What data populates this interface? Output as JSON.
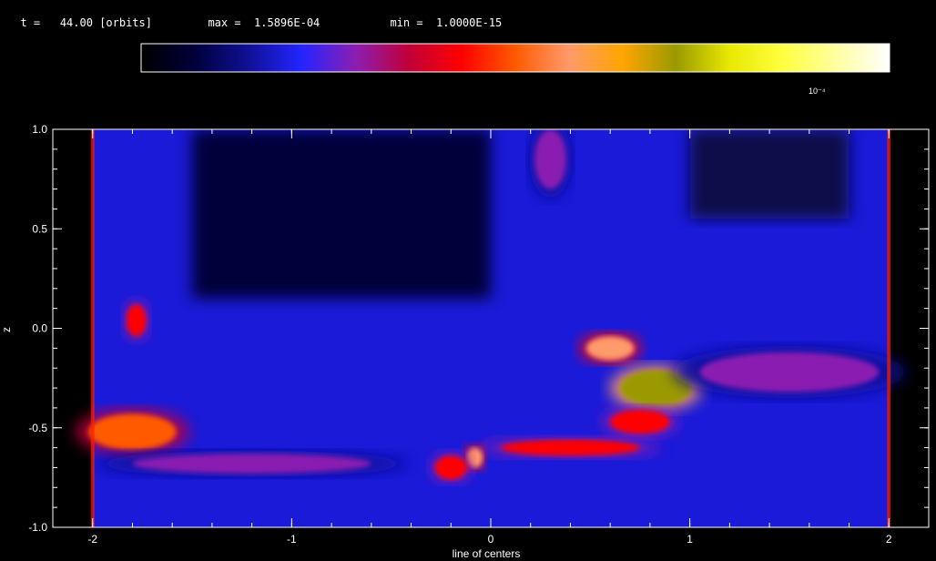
{
  "header": {
    "time_label": "t =",
    "time_value": "44.00",
    "time_unit": "[orbits]",
    "max_label": "max =",
    "max_value": "1.5896E-04",
    "min_label": "min =",
    "min_value": "1.0000E-15"
  },
  "colorbar": {
    "exponent_label": "10⁻⁴",
    "colors": [
      "#000000",
      "#00003a",
      "#101094",
      "#2424ff",
      "#8a1fb2",
      "#c0003a",
      "#ff0000",
      "#ff5a00",
      "#ff9a6a",
      "#ffa500",
      "#9a9a00",
      "#e8e800",
      "#ffff40",
      "#ffffa0",
      "#ffffff"
    ]
  },
  "chart_data": {
    "type": "heatmap",
    "title": "",
    "xlabel": "line of centers",
    "ylabel": "z",
    "xlim": [
      -2.2,
      2.2
    ],
    "ylim": [
      -1.0,
      1.0
    ],
    "grid": false,
    "x_ticks": [
      {
        "value": -2,
        "label": "-2"
      },
      {
        "value": -1,
        "label": "-1"
      },
      {
        "value": 0,
        "label": "0"
      },
      {
        "value": 1,
        "label": "1"
      },
      {
        "value": 2,
        "label": "2"
      }
    ],
    "y_ticks": [
      {
        "value": 1.0,
        "label": "1.0"
      },
      {
        "value": 0.5,
        "label": "0.5"
      },
      {
        "value": 0.0,
        "label": "0.0"
      },
      {
        "value": -0.5,
        "label": "-0.5"
      },
      {
        "value": -1.0,
        "label": "-1.0"
      }
    ],
    "data_extent_x": [
      -2.0,
      2.0
    ],
    "background_color": "#1a1ad8",
    "features": [
      {
        "x": -1.78,
        "y": 0.04,
        "value_fraction": 0.45,
        "rx": 0.05,
        "ry": 0.08
      },
      {
        "x": -1.8,
        "y": -0.52,
        "value_fraction": 0.5,
        "rx": 0.22,
        "ry": 0.09
      },
      {
        "x": -1.2,
        "y": -0.68,
        "value_fraction": 0.28,
        "rx": 0.6,
        "ry": 0.05
      },
      {
        "x": 0.6,
        "y": -0.1,
        "value_fraction": 0.55,
        "rx": 0.12,
        "ry": 0.06
      },
      {
        "x": 0.83,
        "y": -0.3,
        "value_fraction": 0.72,
        "rx": 0.18,
        "ry": 0.09
      },
      {
        "x": 1.5,
        "y": -0.22,
        "value_fraction": 0.3,
        "rx": 0.45,
        "ry": 0.1
      },
      {
        "x": 0.75,
        "y": -0.47,
        "value_fraction": 0.4,
        "rx": 0.15,
        "ry": 0.06
      },
      {
        "x": 0.4,
        "y": -0.6,
        "value_fraction": 0.42,
        "rx": 0.35,
        "ry": 0.04
      },
      {
        "x": -0.08,
        "y": -0.65,
        "value_fraction": 0.6,
        "rx": 0.04,
        "ry": 0.05
      },
      {
        "x": -0.2,
        "y": -0.7,
        "value_fraction": 0.4,
        "rx": 0.08,
        "ry": 0.06
      },
      {
        "x": 0.3,
        "y": 0.85,
        "value_fraction": 0.28,
        "rx": 0.08,
        "ry": 0.15
      }
    ]
  }
}
